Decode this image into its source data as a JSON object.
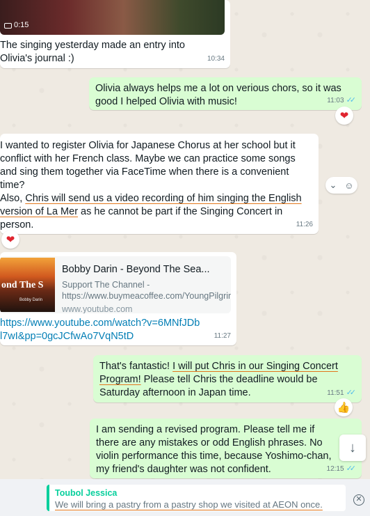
{
  "colors": {
    "incoming_bubble": "#ffffff",
    "outgoing_bubble": "#d9fdd3",
    "read_ticks": "#53bdeb",
    "quote_accent": "#06cf9c",
    "link": "#027eb5"
  },
  "messages": [
    {
      "direction": "in",
      "video_duration": "0:15",
      "text": "The singing yesterday made an entry into Olivia's journal :)",
      "time": "10:34"
    },
    {
      "direction": "out",
      "text": "Olivia always helps me a lot on verious chors, so it was good I helped Olivia with music!",
      "time": "11:03",
      "status_icon": "double-check-read",
      "reaction": "❤"
    },
    {
      "direction": "in",
      "text_line1": "I wanted to register Olivia for Japanese Chorus at her school but it conflict with her French class. Maybe we can practice some songs and sing them together via FaceTime when there is a convenient time?",
      "text_line2_prefix": "Also, ",
      "text_line2_underlined": "Chris will send us a video recording of him singing the English version of La Mer",
      "text_line2_suffix": " as he cannot be part if the Singing Concert in person.",
      "time": "11:26",
      "reaction": "❤"
    },
    {
      "direction": "in",
      "link_title": "Bobby Darin - Beyond The Sea...",
      "link_desc": "Support The Channel - https://www.buymeacoffee.com/YoungPilgrim",
      "link_domain": "www.youtube.com",
      "thumb_text": "ond The S",
      "thumb_subtext": "Bobby Darin",
      "url": "https://www.youtube.com/watch?v=6MNfJDbl7wI&pp=0gcJCfwAo7VqN5tD",
      "time": "11:27"
    },
    {
      "direction": "out",
      "text_prefix": "That's fantastic! ",
      "text_underlined": "I will put Chris in our Singing Concert Program!",
      "text_suffix": " Please tell Chris the deadline would be Saturday afternoon in Japan time.",
      "time": "11:51",
      "status_icon": "double-check-read",
      "reaction": "👍"
    },
    {
      "direction": "out",
      "text": "I am sending a revised program. Please tell me if there are any mistakes or odd  English phrases. No violin performance this time, because Yoshimo-chan, my friend's daughter was not confident.",
      "time": "12:15",
      "status_icon": "double-check-read"
    }
  ],
  "hover_actions": {
    "dropdown_icon": "chevron-down-icon",
    "emoji_icon": "emoji-icon"
  },
  "scroll_button_icon": "arrow-down-icon",
  "reply_preview": {
    "author": "Toubol Jessica",
    "text": "We will bring a pastry from a pastry shop we visited at AEON once."
  }
}
